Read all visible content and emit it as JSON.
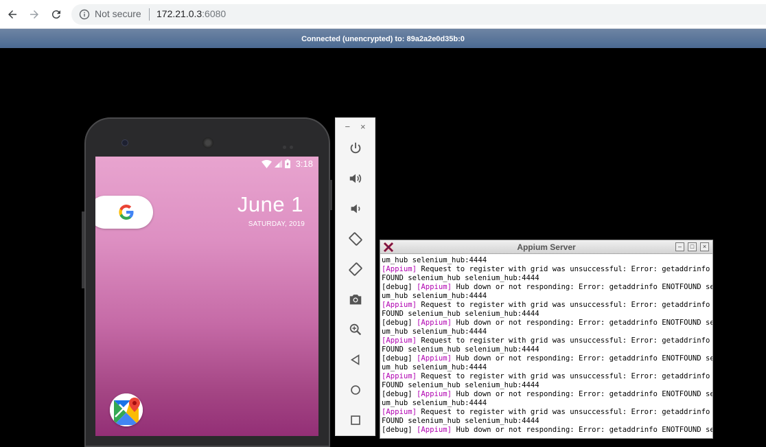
{
  "browser": {
    "security_label": "Not secure",
    "url_host": "172.21.0.3",
    "url_port": ":6080",
    "icons": [
      "back-icon",
      "forward-icon",
      "reload-icon",
      "info-icon"
    ]
  },
  "vnc": {
    "status": "Connected (unencrypted) to: 89a2a2e0d35b:0"
  },
  "phone": {
    "time": "3:18",
    "date_big": "June 1",
    "date_small": "SATURDAY, 2019",
    "apps": [
      "google-search-widget",
      "maps-icon"
    ]
  },
  "emulator_toolbar": {
    "minimize": "−",
    "close": "×",
    "buttons": [
      "power-icon",
      "volume-up-icon",
      "volume-down-icon",
      "rotate-left-icon",
      "rotate-right-icon",
      "camera-icon",
      "zoom-icon",
      "back-icon",
      "home-icon",
      "overview-icon"
    ]
  },
  "appium": {
    "title": "Appium Server",
    "lines": [
      {
        "tag_prefix": "",
        "tag": "",
        "text": "um_hub selenium_hub:4444"
      },
      {
        "tag_prefix": "",
        "tag": "[Appium]",
        "text": " Request to register with grid was unsuccessful: Error: getaddrinfo ENOT"
      },
      {
        "tag_prefix": "",
        "tag": "",
        "text": "FOUND selenium_hub selenium_hub:4444"
      },
      {
        "tag_prefix": "[debug] ",
        "tag": "[Appium]",
        "text": " Hub down or not responding: Error: getaddrinfo ENOTFOUND seleni"
      },
      {
        "tag_prefix": "",
        "tag": "",
        "text": "um_hub selenium_hub:4444"
      },
      {
        "tag_prefix": "",
        "tag": "[Appium]",
        "text": " Request to register with grid was unsuccessful: Error: getaddrinfo ENOT"
      },
      {
        "tag_prefix": "",
        "tag": "",
        "text": "FOUND selenium_hub selenium_hub:4444"
      },
      {
        "tag_prefix": "[debug] ",
        "tag": "[Appium]",
        "text": " Hub down or not responding: Error: getaddrinfo ENOTFOUND seleni"
      },
      {
        "tag_prefix": "",
        "tag": "",
        "text": "um_hub selenium_hub:4444"
      },
      {
        "tag_prefix": "",
        "tag": "[Appium]",
        "text": " Request to register with grid was unsuccessful: Error: getaddrinfo ENOT"
      },
      {
        "tag_prefix": "",
        "tag": "",
        "text": "FOUND selenium_hub selenium_hub:4444"
      },
      {
        "tag_prefix": "[debug] ",
        "tag": "[Appium]",
        "text": " Hub down or not responding: Error: getaddrinfo ENOTFOUND seleni"
      },
      {
        "tag_prefix": "",
        "tag": "",
        "text": "um_hub selenium_hub:4444"
      },
      {
        "tag_prefix": "",
        "tag": "[Appium]",
        "text": " Request to register with grid was unsuccessful: Error: getaddrinfo ENOT"
      },
      {
        "tag_prefix": "",
        "tag": "",
        "text": "FOUND selenium_hub selenium_hub:4444"
      },
      {
        "tag_prefix": "[debug] ",
        "tag": "[Appium]",
        "text": " Hub down or not responding: Error: getaddrinfo ENOTFOUND seleni"
      },
      {
        "tag_prefix": "",
        "tag": "",
        "text": "um_hub selenium_hub:4444"
      },
      {
        "tag_prefix": "",
        "tag": "[Appium]",
        "text": " Request to register with grid was unsuccessful: Error: getaddrinfo ENOT"
      },
      {
        "tag_prefix": "",
        "tag": "",
        "text": "FOUND selenium_hub selenium_hub:4444"
      },
      {
        "tag_prefix": "[debug] ",
        "tag": "[Appium]",
        "text": " Hub down or not responding: Error: getaddrinfo ENOTFOUND seleni"
      }
    ]
  }
}
